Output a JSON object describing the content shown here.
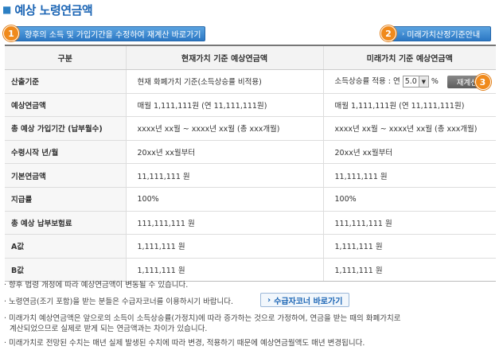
{
  "page": {
    "title": "예상 노령연금액"
  },
  "buttons": {
    "recalc_link": {
      "badge": "1",
      "label": "향후의 소득 및 가입기간을 수정하여 재계산 바로가기"
    },
    "future_value_guide": {
      "badge": "2",
      "label": "미래가치산정기준안내"
    },
    "recalc": {
      "label": "재계산",
      "badge": "3"
    },
    "recipient_corner": {
      "label": "수급자코너 바로가기"
    }
  },
  "table": {
    "headers": [
      "구분",
      "현재가치 기준 예상연금액",
      "미래가치 기준 예상연금액"
    ],
    "rows": [
      {
        "label": "산출기준",
        "current": "현재 화폐가치 기준(소득상승률 비적용)",
        "future_prefix": "소득상승률 적용 : 연",
        "future_rate": "5.0",
        "future_unit": "%"
      },
      {
        "label": "예상연금액",
        "current": "매월 1,111,111원 (연 11,111,111원)",
        "future": "매월 1,111,111원 (연 11,111,111원)"
      },
      {
        "label": "총 예상 가입기간 (납부월수)",
        "current": "xxxx년 xx월 ~ xxxx년 xx월 (총 xxx개월)",
        "future": "xxxx년 xx월 ~ xxxx년 xx월 (총 xxx개월)"
      },
      {
        "label": "수령시작 년/월",
        "current": "20xx년 xx월부터",
        "future": "20xx년 xx월부터"
      },
      {
        "label": "기본연금액",
        "current": "11,111,111 원",
        "future": "11,111,111 원"
      },
      {
        "label": "지급률",
        "current": "100%",
        "future": "100%"
      },
      {
        "label": "총 예상 납부보험료",
        "current": "111,111,111 원",
        "future": "111,111,111 원"
      },
      {
        "label": "A값",
        "current": "1,111,111 원",
        "future": "1,111,111 원"
      },
      {
        "label": "B값",
        "current": "1,111,111 원",
        "future": "1,111,111 원"
      }
    ]
  },
  "notes": [
    "향후 법령 개정에 따라 예상연금액이 변동될 수 있습니다.",
    "노령연금(조기 포함)을 받는 분들은 수급자코너를 이용하시기 바랍니다.",
    "미래가치 예상연금액은 앞으로의 소득이 소득상승률(가정치)에 따라 증가하는 것으로 가정하여, 연금을 받는 때의 화폐가치로",
    "계산되었으므로 실제로 받게 되는 연금액과는 차이가 있습니다.",
    "미래가치로 전망된 수치는 매년 실제 발생된 수치에 따라 변경, 적용하기 때문에 예상연금월액도 매년 변경됩니다."
  ],
  "colors": {
    "title_blue": "#1a64b4",
    "badge_orange": "#f08a1c",
    "button_blue": "#2c78c4"
  }
}
